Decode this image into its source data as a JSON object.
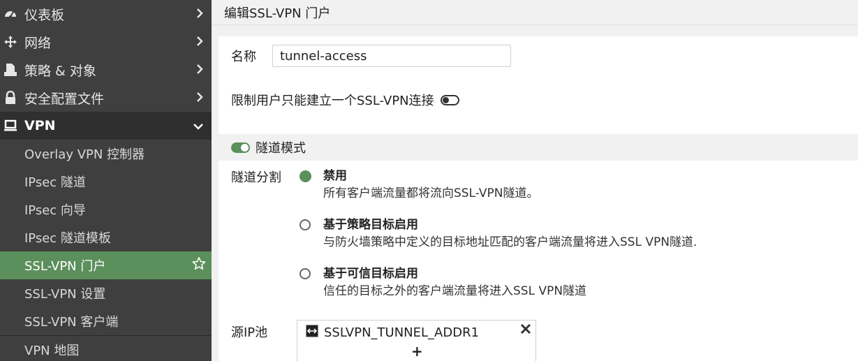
{
  "sidebar": {
    "items": [
      {
        "label": "仪表板",
        "icon": "dashboard-icon"
      },
      {
        "label": "网络",
        "icon": "network-icon"
      },
      {
        "label": "策略 & 对象",
        "icon": "policy-icon"
      },
      {
        "label": "安全配置文件",
        "icon": "lock-icon"
      }
    ],
    "section": {
      "label": "VPN",
      "icon": "laptop-icon"
    },
    "subitems": [
      {
        "label": "Overlay VPN 控制器"
      },
      {
        "label": "IPsec 隧道"
      },
      {
        "label": "IPsec 向导"
      },
      {
        "label": "IPsec 隧道模板"
      },
      {
        "label": "SSL-VPN 门户"
      },
      {
        "label": "SSL-VPN 设置"
      },
      {
        "label": "SSL-VPN 客户端"
      }
    ],
    "vpn_map": {
      "label": "VPN 地图"
    },
    "accent_color": "#5b8f5b"
  },
  "main": {
    "title": "编辑SSL-VPN 门户",
    "name_label": "名称",
    "name_value": "tunnel-access",
    "limit_label": "限制用户只能建立一个SSL-VPN连接",
    "limit_enabled": false,
    "tunnel_mode_label": "隧道模式",
    "tunnel_mode_enabled": true,
    "split_label": "隧道分割",
    "split_options": [
      {
        "title": "禁用",
        "desc": "所有客户端流量都将流向SSL-VPN隧道。",
        "selected": true
      },
      {
        "title": "基于策略目标启用",
        "desc": "与防火墙策略中定义的目标地址匹配的客户端流量将进入SSL VPN隧道.",
        "selected": false
      },
      {
        "title": "基于可信目标启用",
        "desc": "信任的目标之外的客户端流量将进入SSL VPN隧道",
        "selected": false
      }
    ],
    "pool_label": "源IP池",
    "pool_entry": "SSLVPN_TUNNEL_ADDR1",
    "pool_add": "+"
  }
}
